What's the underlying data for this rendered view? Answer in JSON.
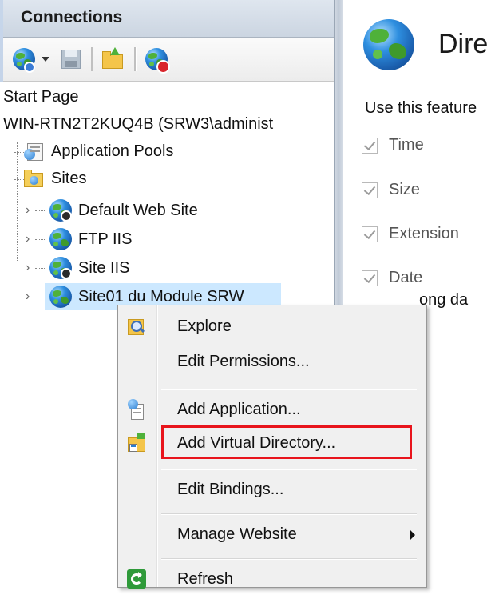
{
  "connections": {
    "title": "Connections",
    "toolbar": {
      "icons": [
        "connect-globe-icon",
        "dropdown-arrow-icon",
        "save-icon",
        "open-folder-icon",
        "disconnect-icon"
      ]
    },
    "tree": {
      "start_page": "Start Page",
      "server": "WIN-RTN2T2KUQ4B (SRW3\\administ",
      "app_pools": "Application Pools",
      "sites": "Sites",
      "site_items": [
        "Default Web Site",
        "FTP IIS",
        "Site IIS",
        "Site01 du Module SRW"
      ]
    }
  },
  "feature": {
    "title": "Dire",
    "description": "Use this feature",
    "options": [
      "Time",
      "Size",
      "Extension",
      "Date"
    ],
    "long_date": "ong da"
  },
  "context_menu": {
    "items": [
      {
        "label": "Explore",
        "icon": "explore-icon"
      },
      {
        "label": "Edit Permissions...",
        "icon": ""
      },
      {
        "label": "Add Application...",
        "icon": "add-application-icon"
      },
      {
        "label": "Add Virtual Directory...",
        "icon": "add-virtual-directory-icon"
      },
      {
        "label": "Edit Bindings...",
        "icon": ""
      },
      {
        "label": "Manage Website",
        "icon": "",
        "submenu": true
      },
      {
        "label": "Refresh",
        "icon": "refresh-icon"
      }
    ]
  },
  "colors": {
    "selection": "#cce8ff",
    "highlight_box": "#e8141c",
    "menu_background": "#f0f0f0"
  }
}
